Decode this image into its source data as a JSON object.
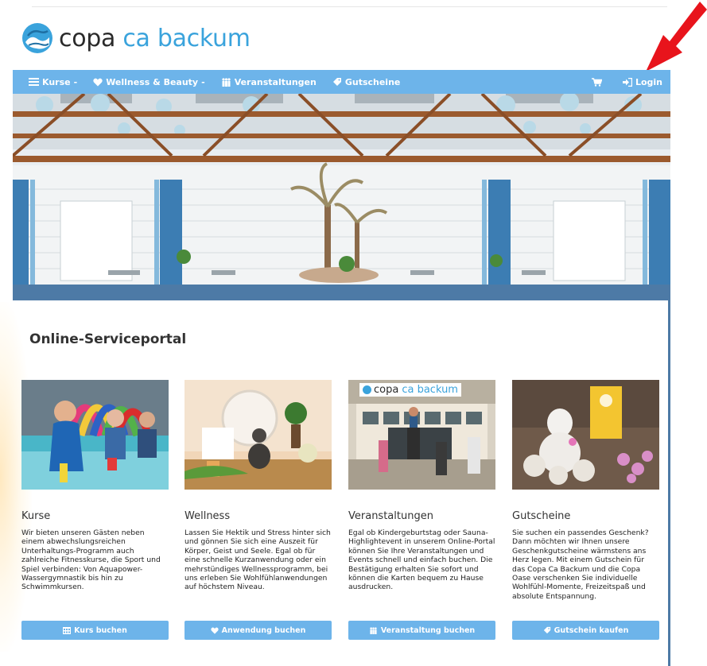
{
  "brand": {
    "name_dark": "copa",
    "name_light": "ca backum"
  },
  "nav": {
    "items": [
      {
        "label": "Kurse",
        "icon": "list-icon",
        "dropdown": true
      },
      {
        "label": "Wellness & Beauty",
        "icon": "heart-icon",
        "dropdown": true
      },
      {
        "label": "Veranstaltungen",
        "icon": "people-icon",
        "dropdown": false
      },
      {
        "label": "Gutscheine",
        "icon": "tag-icon",
        "dropdown": false
      }
    ],
    "cart_icon": "cart-icon",
    "login_label": "Login",
    "login_icon": "login-icon",
    "dropdown_caret": "-"
  },
  "page": {
    "title": "Online-Serviceportal"
  },
  "cards": [
    {
      "title": "Kurse",
      "description": "Wir bieten unseren Gästen neben einem abwechslungsreichen Unterhaltungs-Programm auch zahlreiche Fitnesskurse, die Sport und Spiel verbinden: Von Aquapower-Wassergymnastik bis hin zu Schwimmkursen.",
      "button": "Kurs buchen",
      "button_icon": "table-icon"
    },
    {
      "title": "Wellness",
      "description": "Lassen Sie Hektik und Stress hinter sich und gönnen Sie sich eine Auszeit für Körper, Geist und Seele. Egal ob für eine schnelle Kurzanwendung oder ein mehrstündiges Wellnessprogramm, bei uns erleben Sie Wohlfühlanwendungen auf höchstem Niveau.",
      "button": "Anwendung buchen",
      "button_icon": "heart-icon"
    },
    {
      "title": "Veranstaltungen",
      "description": "Egal ob Kindergeburtstag oder Sauna-Highlightevent in unserem Online-Portal können Sie Ihre Veranstaltungen und Events schnell und einfach buchen. Die Bestätigung erhalten Sie sofort und können die Karten bequem zu Hause ausdrucken.",
      "button": "Veranstaltung buchen",
      "button_icon": "people-icon",
      "photo_sign": {
        "dark": "copa",
        "light": "ca backum"
      }
    },
    {
      "title": "Gutscheine",
      "description": "Sie suchen ein passendes Geschenk? Dann möchten wir Ihnen unsere Geschenkgutscheine wärmstens ans Herz legen. Mit einem Gutschein für das Copa Ca Backum und die Copa Oase verschenken Sie individuelle Wohlfühl-Momente, Freizeitspaß und absolute Entspannung.",
      "button": "Gutschein kaufen",
      "button_icon": "tag-icon"
    }
  ],
  "colors": {
    "nav": "#6db4ea",
    "brand_blue": "#3aa3dc",
    "band": "#4d7aa6",
    "arrow": "#e8141c"
  }
}
